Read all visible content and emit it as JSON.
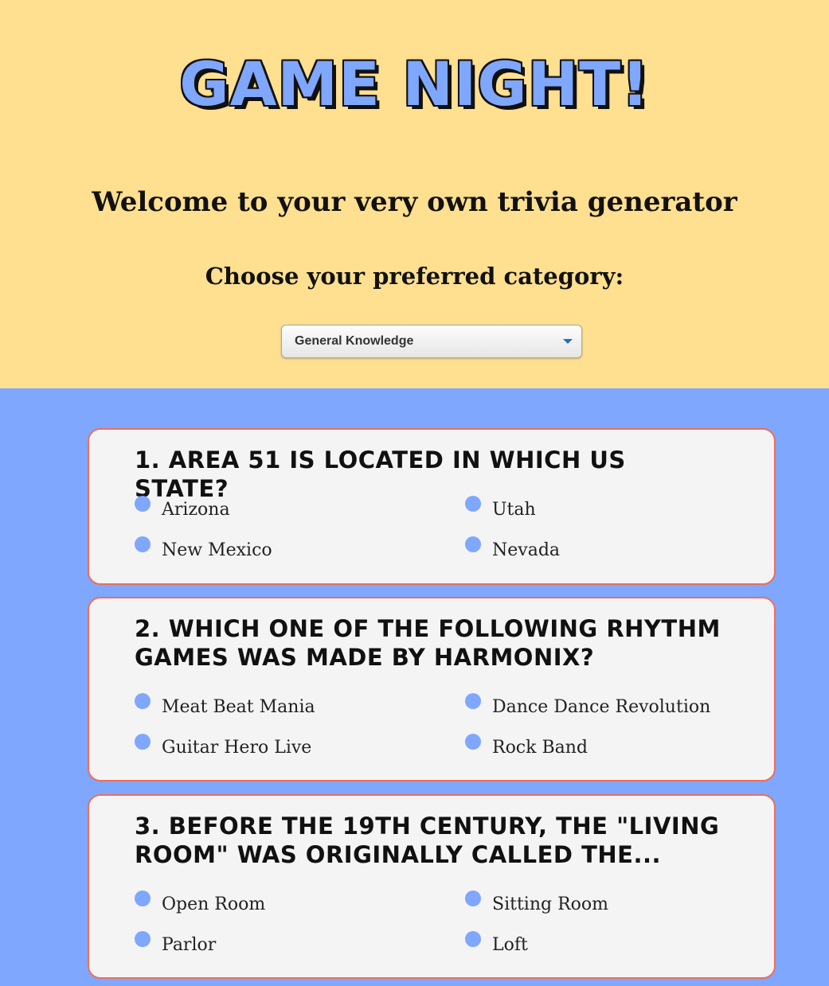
{
  "header": {
    "title": "GAME NIGHT!",
    "welcome": "Welcome to your very own trivia generator",
    "choose_prompt": "Choose your preferred category:",
    "category_select": {
      "selected": "General Knowledge",
      "icon": "chevron-down-icon"
    }
  },
  "colors": {
    "header_bg": "#ffdf90",
    "body_bg": "#7fa7fd",
    "card_bg": "#f4f4f4",
    "card_border": "#ee6e5c",
    "radio_dot": "#7fa7fd"
  },
  "questions": [
    {
      "text": "1. Area 51 is located in which US state?",
      "answers": [
        "Arizona",
        "Utah",
        "New Mexico",
        "Nevada"
      ]
    },
    {
      "text": "2. Which one of the following rhythm games was made by Harmonix?",
      "answers": [
        "Meat Beat Mania",
        "Dance Dance Revolution",
        "Guitar Hero Live",
        "Rock Band"
      ]
    },
    {
      "text": "3. Before the 19th century, the \"Living Room\" was originally called the...",
      "answers": [
        "Open Room",
        "Sitting Room",
        "Parlor",
        "Loft"
      ]
    }
  ]
}
